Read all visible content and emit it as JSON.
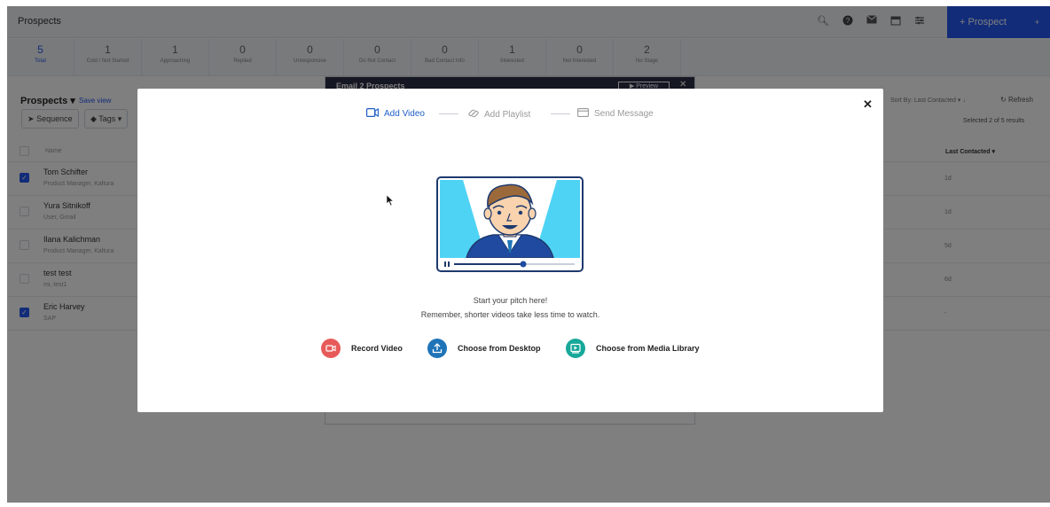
{
  "app": {
    "title": "Prospects",
    "new_prospect_label": "+ Prospect",
    "new_prospect_caret": "+"
  },
  "stats": [
    {
      "count": "5",
      "label": "Total"
    },
    {
      "count": "1",
      "label": "Cold / Not Started"
    },
    {
      "count": "1",
      "label": "Approaching"
    },
    {
      "count": "0",
      "label": "Replied"
    },
    {
      "count": "0",
      "label": "Unresponsive"
    },
    {
      "count": "0",
      "label": "Do Not Contact"
    },
    {
      "count": "0",
      "label": "Bad Contact Info"
    },
    {
      "count": "1",
      "label": "Interested"
    },
    {
      "count": "0",
      "label": "Not Interested"
    },
    {
      "count": "2",
      "label": "No Stage"
    }
  ],
  "list": {
    "heading": "Prospects",
    "save_view": "Save view",
    "sequence_btn": "Sequence",
    "tags_btn": "Tags",
    "name_col": "Name",
    "sort_by": "Sort By: Last Contacted",
    "refresh": "Refresh",
    "selected": "Selected 2 of 5 results",
    "last_contacted_col": "Last Contacted",
    "rows": [
      {
        "name": "Tom Schifter",
        "sub": "Product Manager, Kaltura",
        "last": "1d"
      },
      {
        "name": "Yura Sitnikoff",
        "sub": "User, Gmail",
        "last": "1d"
      },
      {
        "name": "Ilana Kalichman",
        "sub": "Product Manager, Kaltura",
        "last": "5d"
      },
      {
        "name": "test test",
        "sub": "mi, test1",
        "last": "6d"
      },
      {
        "name": "Eric Harvey",
        "sub": "SAP",
        "last": "-"
      }
    ]
  },
  "email_panel": {
    "title": "Email 2 Prospects",
    "preview": "Preview"
  },
  "modal": {
    "steps": [
      "Add Video",
      "Add Playlist",
      "Send Message"
    ],
    "pitch_line1": "Start your pitch here!",
    "pitch_line2": "Remember, shorter videos take less time to watch.",
    "actions": {
      "record": "Record Video",
      "desktop": "Choose from Desktop",
      "library": "Choose from Media Library"
    }
  },
  "colors": {
    "accent": "#2458f2",
    "record": "#e85a5a",
    "desktop": "#1f74b8",
    "library": "#17a89a",
    "active_step": "#1f5fc8"
  }
}
